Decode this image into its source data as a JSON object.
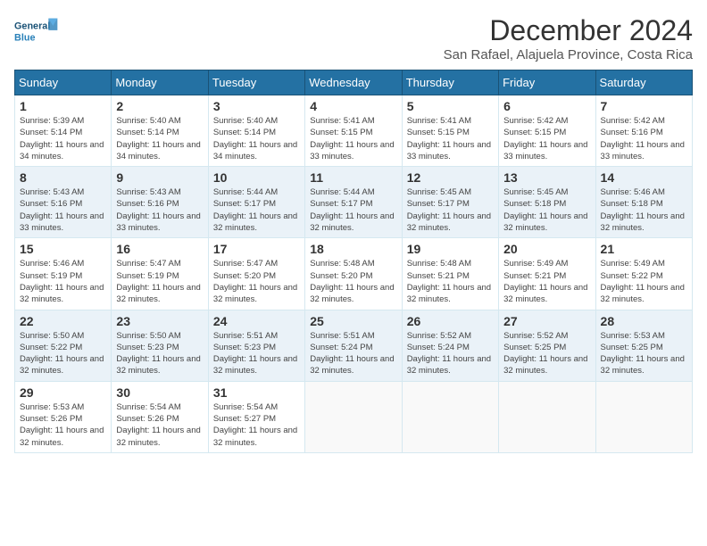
{
  "logo": {
    "line1": "General",
    "line2": "Blue"
  },
  "title": "December 2024",
  "subtitle": "San Rafael, Alajuela Province, Costa Rica",
  "weekdays": [
    "Sunday",
    "Monday",
    "Tuesday",
    "Wednesday",
    "Thursday",
    "Friday",
    "Saturday"
  ],
  "weeks": [
    [
      {
        "day": "1",
        "sunrise": "5:39 AM",
        "sunset": "5:14 PM",
        "daylight": "11 hours and 34 minutes."
      },
      {
        "day": "2",
        "sunrise": "5:40 AM",
        "sunset": "5:14 PM",
        "daylight": "11 hours and 34 minutes."
      },
      {
        "day": "3",
        "sunrise": "5:40 AM",
        "sunset": "5:14 PM",
        "daylight": "11 hours and 34 minutes."
      },
      {
        "day": "4",
        "sunrise": "5:41 AM",
        "sunset": "5:15 PM",
        "daylight": "11 hours and 33 minutes."
      },
      {
        "day": "5",
        "sunrise": "5:41 AM",
        "sunset": "5:15 PM",
        "daylight": "11 hours and 33 minutes."
      },
      {
        "day": "6",
        "sunrise": "5:42 AM",
        "sunset": "5:15 PM",
        "daylight": "11 hours and 33 minutes."
      },
      {
        "day": "7",
        "sunrise": "5:42 AM",
        "sunset": "5:16 PM",
        "daylight": "11 hours and 33 minutes."
      }
    ],
    [
      {
        "day": "8",
        "sunrise": "5:43 AM",
        "sunset": "5:16 PM",
        "daylight": "11 hours and 33 minutes."
      },
      {
        "day": "9",
        "sunrise": "5:43 AM",
        "sunset": "5:16 PM",
        "daylight": "11 hours and 33 minutes."
      },
      {
        "day": "10",
        "sunrise": "5:44 AM",
        "sunset": "5:17 PM",
        "daylight": "11 hours and 32 minutes."
      },
      {
        "day": "11",
        "sunrise": "5:44 AM",
        "sunset": "5:17 PM",
        "daylight": "11 hours and 32 minutes."
      },
      {
        "day": "12",
        "sunrise": "5:45 AM",
        "sunset": "5:17 PM",
        "daylight": "11 hours and 32 minutes."
      },
      {
        "day": "13",
        "sunrise": "5:45 AM",
        "sunset": "5:18 PM",
        "daylight": "11 hours and 32 minutes."
      },
      {
        "day": "14",
        "sunrise": "5:46 AM",
        "sunset": "5:18 PM",
        "daylight": "11 hours and 32 minutes."
      }
    ],
    [
      {
        "day": "15",
        "sunrise": "5:46 AM",
        "sunset": "5:19 PM",
        "daylight": "11 hours and 32 minutes."
      },
      {
        "day": "16",
        "sunrise": "5:47 AM",
        "sunset": "5:19 PM",
        "daylight": "11 hours and 32 minutes."
      },
      {
        "day": "17",
        "sunrise": "5:47 AM",
        "sunset": "5:20 PM",
        "daylight": "11 hours and 32 minutes."
      },
      {
        "day": "18",
        "sunrise": "5:48 AM",
        "sunset": "5:20 PM",
        "daylight": "11 hours and 32 minutes."
      },
      {
        "day": "19",
        "sunrise": "5:48 AM",
        "sunset": "5:21 PM",
        "daylight": "11 hours and 32 minutes."
      },
      {
        "day": "20",
        "sunrise": "5:49 AM",
        "sunset": "5:21 PM",
        "daylight": "11 hours and 32 minutes."
      },
      {
        "day": "21",
        "sunrise": "5:49 AM",
        "sunset": "5:22 PM",
        "daylight": "11 hours and 32 minutes."
      }
    ],
    [
      {
        "day": "22",
        "sunrise": "5:50 AM",
        "sunset": "5:22 PM",
        "daylight": "11 hours and 32 minutes."
      },
      {
        "day": "23",
        "sunrise": "5:50 AM",
        "sunset": "5:23 PM",
        "daylight": "11 hours and 32 minutes."
      },
      {
        "day": "24",
        "sunrise": "5:51 AM",
        "sunset": "5:23 PM",
        "daylight": "11 hours and 32 minutes."
      },
      {
        "day": "25",
        "sunrise": "5:51 AM",
        "sunset": "5:24 PM",
        "daylight": "11 hours and 32 minutes."
      },
      {
        "day": "26",
        "sunrise": "5:52 AM",
        "sunset": "5:24 PM",
        "daylight": "11 hours and 32 minutes."
      },
      {
        "day": "27",
        "sunrise": "5:52 AM",
        "sunset": "5:25 PM",
        "daylight": "11 hours and 32 minutes."
      },
      {
        "day": "28",
        "sunrise": "5:53 AM",
        "sunset": "5:25 PM",
        "daylight": "11 hours and 32 minutes."
      }
    ],
    [
      {
        "day": "29",
        "sunrise": "5:53 AM",
        "sunset": "5:26 PM",
        "daylight": "11 hours and 32 minutes."
      },
      {
        "day": "30",
        "sunrise": "5:54 AM",
        "sunset": "5:26 PM",
        "daylight": "11 hours and 32 minutes."
      },
      {
        "day": "31",
        "sunrise": "5:54 AM",
        "sunset": "5:27 PM",
        "daylight": "11 hours and 32 minutes."
      },
      null,
      null,
      null,
      null
    ]
  ],
  "labels": {
    "sunrise": "Sunrise:",
    "sunset": "Sunset:",
    "daylight": "Daylight:"
  }
}
